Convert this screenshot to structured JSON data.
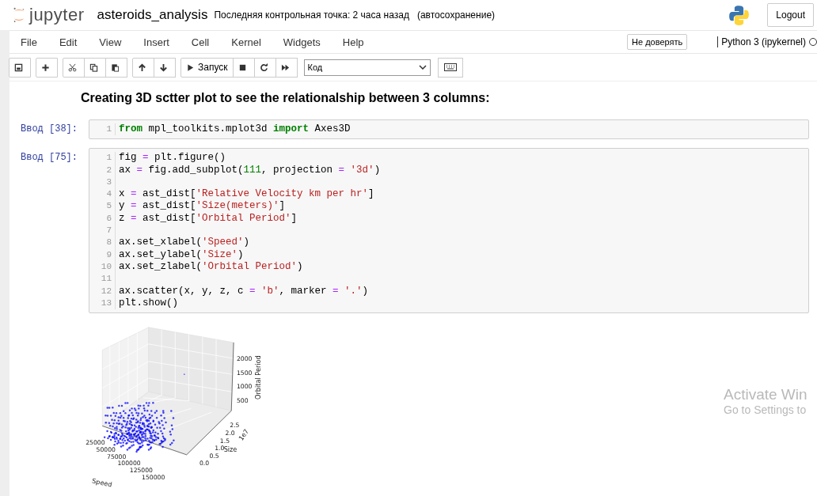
{
  "header": {
    "logo_text": "jupyter",
    "notebook_name": "asteroids_analysis",
    "checkpoint": "Последняя контрольная точка: 2 часа назад",
    "autosave": "(автосохранение)",
    "logout": "Logout"
  },
  "menu": {
    "items": [
      "File",
      "Edit",
      "View",
      "Insert",
      "Cell",
      "Kernel",
      "Widgets",
      "Help"
    ],
    "trust": "Не доверять",
    "kernel": "Python 3 (ipykernel)"
  },
  "toolbar": {
    "groups": [
      [
        {
          "kind": "save"
        }
      ],
      [
        {
          "kind": "add"
        }
      ],
      [
        {
          "kind": "cut"
        },
        {
          "kind": "copy"
        },
        {
          "kind": "paste"
        }
      ],
      [
        {
          "kind": "up"
        },
        {
          "kind": "down"
        }
      ],
      [
        {
          "kind": "run",
          "label": "Запуск"
        },
        {
          "kind": "stop"
        },
        {
          "kind": "restart"
        },
        {
          "kind": "fastforward"
        }
      ]
    ],
    "cell_type": "Код"
  },
  "cells": [
    {
      "kind": "markdown",
      "text": "Creating 3D sctter plot to see the relationalship between 3 columns:"
    },
    {
      "kind": "code",
      "prompt": "Ввод [38]:",
      "lines": [
        {
          "no": "1",
          "tokens": [
            {
              "kind": "keyword",
              "s": "from"
            },
            {
              "kind": "plain",
              "s": " mpl_toolkits.mplot3d "
            },
            {
              "kind": "keyword",
              "s": "import"
            },
            {
              "kind": "plain",
              "s": " Axes3D"
            }
          ]
        }
      ]
    },
    {
      "kind": "code",
      "prompt": "Ввод [75]:",
      "lines": [
        {
          "no": "1",
          "tokens": [
            {
              "kind": "plain",
              "s": "fig"
            },
            {
              "kind": "operator",
              "s": " = "
            },
            {
              "kind": "plain",
              "s": "plt.figure()"
            }
          ]
        },
        {
          "no": "2",
          "tokens": [
            {
              "kind": "plain",
              "s": "ax"
            },
            {
              "kind": "operator",
              "s": " = "
            },
            {
              "kind": "plain",
              "s": "fig.add_subplot("
            },
            {
              "kind": "number",
              "s": "111"
            },
            {
              "kind": "plain",
              "s": ", projection"
            },
            {
              "kind": "operator",
              "s": " = "
            },
            {
              "kind": "string",
              "s": "'3d'"
            },
            {
              "kind": "plain",
              "s": ")"
            }
          ]
        },
        {
          "no": "3"
        },
        {
          "no": "4",
          "tokens": [
            {
              "kind": "plain",
              "s": "x"
            },
            {
              "kind": "operator",
              "s": " = "
            },
            {
              "kind": "plain",
              "s": "ast_dist["
            },
            {
              "kind": "string",
              "s": "'Relative Velocity km per hr'"
            },
            {
              "kind": "plain",
              "s": "]"
            }
          ]
        },
        {
          "no": "5",
          "tokens": [
            {
              "kind": "plain",
              "s": "y"
            },
            {
              "kind": "operator",
              "s": " = "
            },
            {
              "kind": "plain",
              "s": "ast_dist["
            },
            {
              "kind": "string",
              "s": "'Size(meters)'"
            },
            {
              "kind": "plain",
              "s": "]"
            }
          ]
        },
        {
          "no": "6",
          "tokens": [
            {
              "kind": "plain",
              "s": "z"
            },
            {
              "kind": "operator",
              "s": " = "
            },
            {
              "kind": "plain",
              "s": "ast_dist["
            },
            {
              "kind": "string",
              "s": "'Orbital Period'"
            },
            {
              "kind": "plain",
              "s": "]"
            }
          ]
        },
        {
          "no": "7"
        },
        {
          "no": "8",
          "tokens": [
            {
              "kind": "plain",
              "s": "ax.set_xlabel("
            },
            {
              "kind": "string",
              "s": "'Speed'"
            },
            {
              "kind": "plain",
              "s": ")"
            }
          ]
        },
        {
          "no": "9",
          "tokens": [
            {
              "kind": "plain",
              "s": "ax.set_ylabel("
            },
            {
              "kind": "string",
              "s": "'Size'"
            },
            {
              "kind": "plain",
              "s": ")"
            }
          ]
        },
        {
          "no": "10",
          "tokens": [
            {
              "kind": "plain",
              "s": "ax.set_zlabel("
            },
            {
              "kind": "string",
              "s": "'Orbital Period'"
            },
            {
              "kind": "plain",
              "s": ")"
            }
          ]
        },
        {
          "no": "11"
        },
        {
          "no": "12",
          "tokens": [
            {
              "kind": "plain",
              "s": "ax.scatter(x, y, z, c"
            },
            {
              "kind": "operator",
              "s": " = "
            },
            {
              "kind": "string",
              "s": "'b'"
            },
            {
              "kind": "plain",
              "s": ", marker"
            },
            {
              "kind": "operator",
              "s": " = "
            },
            {
              "kind": "string",
              "s": "'.'"
            },
            {
              "kind": "plain",
              "s": ")"
            }
          ]
        },
        {
          "no": "13",
          "tokens": [
            {
              "kind": "plain",
              "s": "plt.show()"
            }
          ]
        }
      ]
    },
    {
      "kind": "plot",
      "zticks": [
        "2000",
        "1500",
        "1000",
        "500"
      ],
      "zlabel": "Orbital Period",
      "offset_label": "1e7",
      "yticks": [
        "2.5",
        "2.0",
        "1.5",
        "1.0",
        "0.5",
        "0.0"
      ],
      "ylabel": "Size",
      "xticks": [
        "25000",
        "50000",
        "75000",
        "100000",
        "125000",
        "150000"
      ],
      "xlabel": "Speed"
    }
  ],
  "os_notice": {
    "title": "Activate Win",
    "subtitle": "Go to Settings to"
  }
}
